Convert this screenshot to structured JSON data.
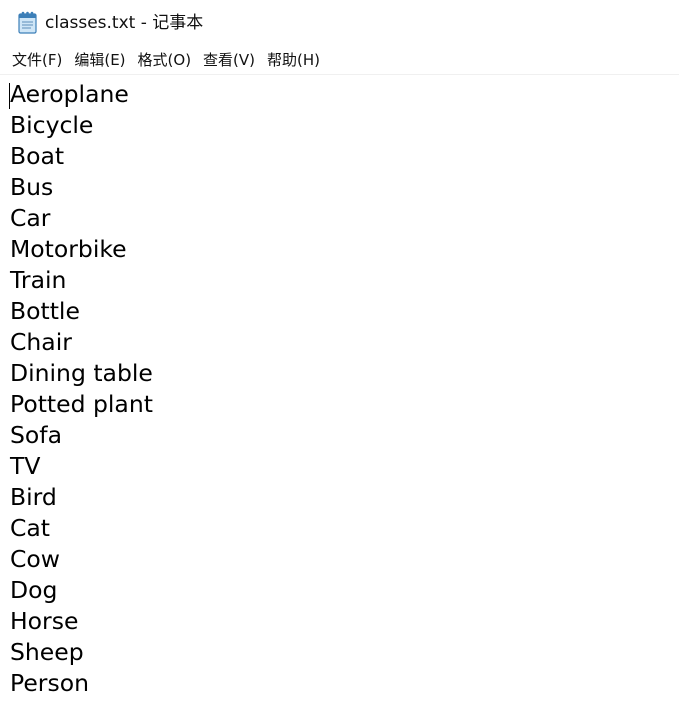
{
  "window": {
    "title": "classes.txt - 记事本",
    "icon": "notepad-icon"
  },
  "menu": {
    "items": [
      {
        "label": "文件(F)"
      },
      {
        "label": "编辑(E)"
      },
      {
        "label": "格式(O)"
      },
      {
        "label": "查看(V)"
      },
      {
        "label": "帮助(H)"
      }
    ]
  },
  "editor": {
    "lines": [
      "Aeroplane",
      "Bicycle",
      "Boat",
      "Bus",
      "Car",
      "Motorbike",
      "Train",
      "Bottle",
      "Chair",
      "Dining table",
      "Potted plant",
      "Sofa",
      "TV",
      "Bird",
      "Cat",
      "Cow",
      "Dog",
      "Horse",
      "Sheep",
      "Person"
    ]
  }
}
